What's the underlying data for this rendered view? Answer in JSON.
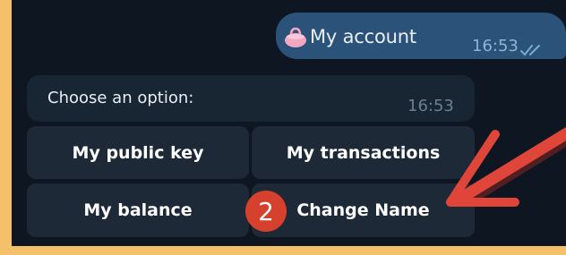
{
  "outgoing_message": {
    "text": "My account",
    "icon": "purse-icon",
    "time": "16:53",
    "status_icon": "double-check-icon"
  },
  "incoming_message": {
    "text": "Choose an option:",
    "time": "16:53"
  },
  "keyboard": {
    "buttons": [
      {
        "label": "My public key"
      },
      {
        "label": "My transactions"
      },
      {
        "label": "My balance"
      },
      {
        "label": "Change Name"
      }
    ]
  },
  "annotation": {
    "step_number": "2",
    "arrow_icon": "red-arrow-icon",
    "badge_color": "#d6412e"
  },
  "colors": {
    "frame": "#f5c06a",
    "chat_background": "#0e1621",
    "outgoing_bubble": "#2b5278",
    "incoming_bubble": "#182533",
    "keyboard_button": "#1d2936"
  }
}
